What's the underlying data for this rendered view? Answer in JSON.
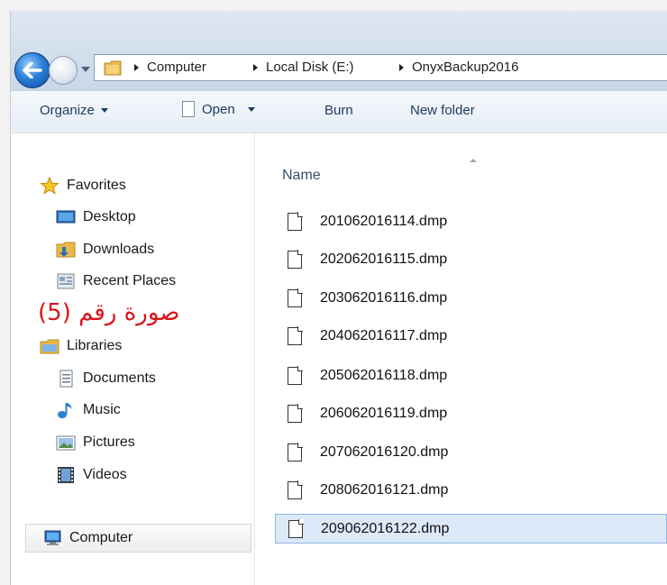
{
  "address_bar": {
    "crumbs": [
      "Computer",
      "Local Disk (E:)",
      "OnyxBackup2016"
    ]
  },
  "toolbar": {
    "organize": "Organize",
    "open": "Open",
    "burn": "Burn",
    "new_folder": "New folder"
  },
  "sidebar": {
    "favorites": "Favorites",
    "desktop": "Desktop",
    "downloads": "Downloads",
    "recent_places": "Recent Places",
    "libraries": "Libraries",
    "documents": "Documents",
    "music": "Music",
    "pictures": "Pictures",
    "videos": "Videos",
    "computer": "Computer"
  },
  "annotation": "صورة رقم (5)",
  "content": {
    "column_name": "Name",
    "files": [
      "201062016114.dmp",
      "202062016115.dmp",
      "203062016116.dmp",
      "204062016117.dmp",
      "205062016118.dmp",
      "206062016119.dmp",
      "207062016120.dmp",
      "208062016121.dmp",
      "209062016122.dmp"
    ],
    "selected_file": "209062016122.dmp"
  },
  "colors": {
    "selection": "#dce9f8",
    "annotation": "#d8161c",
    "toolbar_text": "#1e3a5f"
  }
}
